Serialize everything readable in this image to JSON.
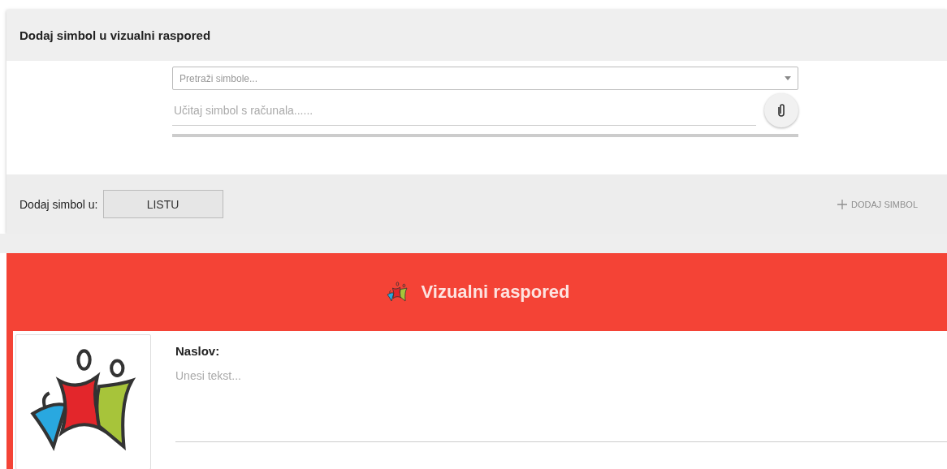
{
  "add_panel": {
    "title": "Dodaj simbol u vizualni raspored",
    "search": {
      "placeholder": "Pretraži simbole..."
    },
    "upload": {
      "placeholder": "Učitaj simbol s računala......"
    },
    "target_label": "Dodaj simbol u:",
    "target_button": "LISTU",
    "add_button": {
      "label": "DODAJ SIMBOL",
      "disabled": true
    }
  },
  "schedule": {
    "title": "Vizualni raspored",
    "heading_label": "Naslov:",
    "text": {
      "placeholder": "Unesi tekst..."
    }
  }
}
